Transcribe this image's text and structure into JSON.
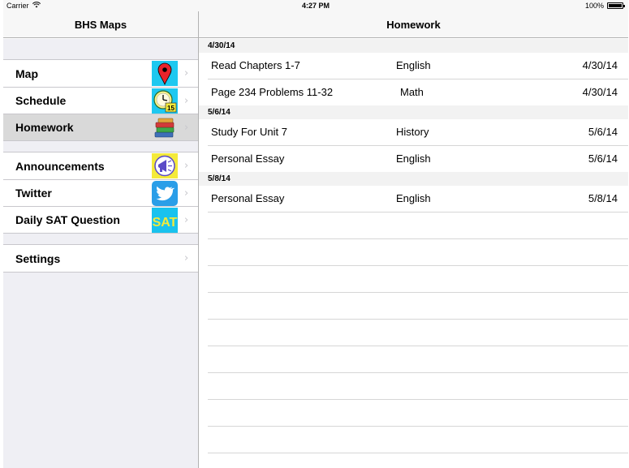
{
  "status_bar": {
    "carrier": "Carrier",
    "time": "4:27 PM",
    "battery": "100%",
    "battery_level": 1.0,
    "wifi_icon": "wifi-icon",
    "battery_icon": "battery-icon"
  },
  "master": {
    "title": "BHS Maps",
    "groups": [
      {
        "items": [
          {
            "label": "Map",
            "icon": "map-pin-icon",
            "selected": false
          },
          {
            "label": "Schedule",
            "icon": "clock-calendar-icon",
            "selected": false
          },
          {
            "label": "Homework",
            "icon": "books-icon",
            "selected": true
          }
        ]
      },
      {
        "items": [
          {
            "label": "Announcements",
            "icon": "megaphone-icon",
            "selected": false
          },
          {
            "label": "Twitter",
            "icon": "twitter-bird-icon",
            "selected": false
          },
          {
            "label": "Daily SAT Question",
            "icon": "sat-icon",
            "selected": false,
            "icon_text": "SAT"
          }
        ]
      },
      {
        "items": [
          {
            "label": "Settings",
            "selected": false
          }
        ]
      }
    ],
    "schedule_icon_number": "15"
  },
  "detail": {
    "title": "Homework",
    "sections": [
      {
        "date": "4/30/14",
        "rows": [
          {
            "title": "Read Chapters 1-7",
            "subject": "English",
            "due": "4/30/14"
          },
          {
            "title": "Page 234 Problems 11-32",
            "subject": "Math",
            "due": "4/30/14"
          }
        ]
      },
      {
        "date": "5/6/14",
        "rows": [
          {
            "title": "Study For Unit 7",
            "subject": "History",
            "due": "5/6/14"
          },
          {
            "title": "Personal Essay",
            "subject": "English",
            "due": "5/6/14"
          }
        ]
      },
      {
        "date": "5/8/14",
        "rows": [
          {
            "title": "Personal Essay",
            "subject": "English",
            "due": "5/8/14"
          }
        ]
      }
    ]
  },
  "colors": {
    "nav_bg": "#f7f7f7",
    "grouped_bg": "#efeff4",
    "selected_row": "#d9d9d9",
    "separator": "#c8c7cc",
    "chevron": "#c7c7cc",
    "map_icon_bg": "#1ec8f0",
    "pin_red": "#e8232b",
    "schedule_icon_bg": "#1ec8f0",
    "megaphone_bg": "#f4ea3a",
    "twitter_bg": "#2a9ee8",
    "sat_bg": "#19c2ee",
    "sat_text": "#f4ea3a"
  }
}
